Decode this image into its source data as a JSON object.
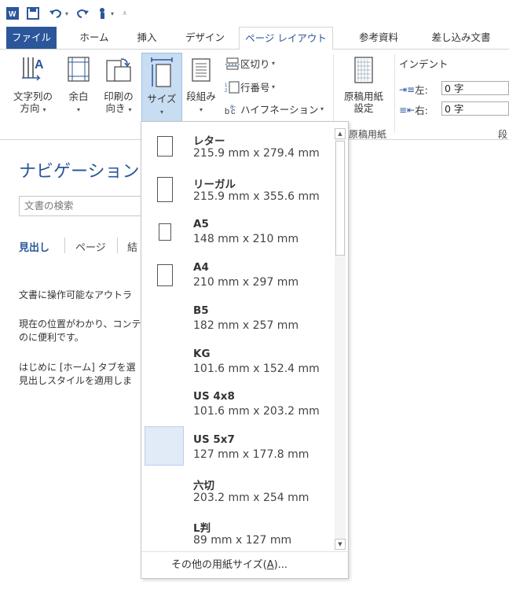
{
  "app": {
    "accent": "#2b579a",
    "qat": {
      "word_icon": "word-icon",
      "save_icon": "save-icon",
      "undo_icon": "undo-icon",
      "redo_icon": "redo-icon",
      "touch_icon": "touch-mode-icon",
      "customize_icon": "customize-qat-icon"
    }
  },
  "tabs": {
    "file": "ファイル",
    "home": "ホーム",
    "insert": "挿入",
    "design": "デザイン",
    "page_layout": "ページ レイアウト",
    "references": "参考資料",
    "mailings": "差し込み文書"
  },
  "ribbon": {
    "text_direction": {
      "line1": "文字列の",
      "line2": "方向"
    },
    "margins": {
      "line1": "余白"
    },
    "orientation": {
      "line1": "印刷の",
      "line2": "向き"
    },
    "size": {
      "line1": "サイズ"
    },
    "columns": {
      "line1": "段組み"
    },
    "breaks": "区切り",
    "line_numbers": "行番号",
    "hyphenation": "ハイフネーション",
    "manuscript": {
      "line1": "原稿用紙",
      "line2": "設定"
    },
    "manuscript_group_label": "原稿用紙",
    "indent": {
      "title": "インデント",
      "left_label": "左:",
      "left_value": "0 字",
      "right_label": "右:",
      "right_value": "0 字"
    },
    "paragraph_group_label": "段"
  },
  "nav_pane": {
    "title": "ナビゲーション",
    "search_placeholder": "文書の検索",
    "tabs": {
      "headings": "見出し",
      "pages": "ページ",
      "results": "結"
    },
    "message_1": "文書に操作可能なアウトラ",
    "message_2a": "現在の位置がわかり、コンテ",
    "message_2b": "のに便利です。",
    "message_3a": "はじめに [ホーム] タブを選",
    "message_3b": "見出しスタイルを適用しま"
  },
  "size_dropdown": {
    "items": [
      {
        "name": "レター",
        "dims": "215.9 mm x 279.4 mm",
        "selected": false
      },
      {
        "name": "リーガル",
        "dims": "215.9 mm x 355.6 mm",
        "selected": false
      },
      {
        "name": "A5",
        "dims": "148 mm x 210 mm",
        "selected": false
      },
      {
        "name": "A4",
        "dims": "210 mm x 297 mm",
        "selected": false
      },
      {
        "name": "B5",
        "dims": "182 mm x 257 mm",
        "selected": false
      },
      {
        "name": "KG",
        "dims": "101.6 mm x 152.4 mm",
        "selected": false
      },
      {
        "name": "US 4x8",
        "dims": "101.6 mm x 203.2 mm",
        "selected": false
      },
      {
        "name": "US 5x7",
        "dims": "127 mm x 177.8 mm",
        "selected": true
      },
      {
        "name": "六切",
        "dims": "203.2 mm x 254 mm",
        "selected": false
      },
      {
        "name": "L判",
        "dims": "89 mm x 127 mm",
        "selected": false
      }
    ],
    "more_sizes": "その他の用紙サイズ(A)...",
    "more_sizes_accel": "A"
  }
}
